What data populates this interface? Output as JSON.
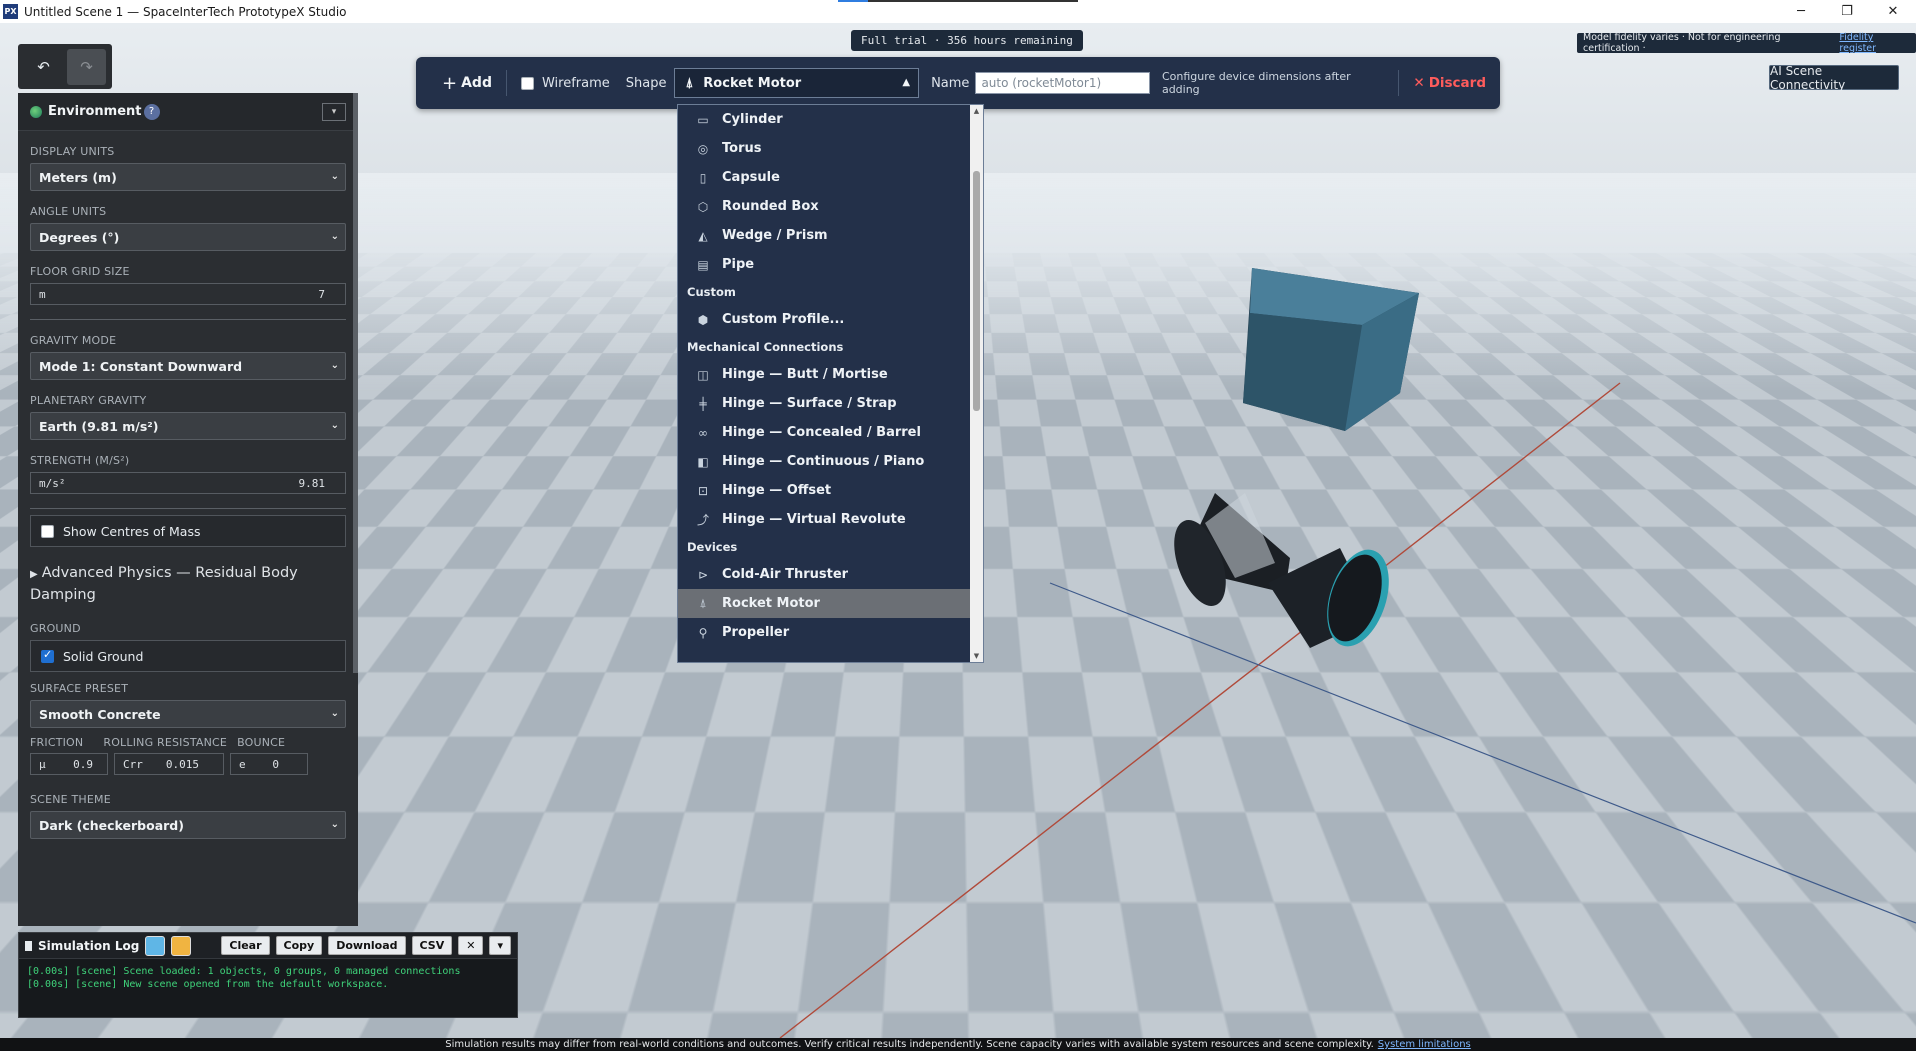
{
  "window": {
    "title": "Untitled Scene 1 — SpaceInterTech PrototypeX Studio",
    "app_icon": "PX",
    "controls": [
      "minimize-icon",
      "restore-icon",
      "close-icon"
    ]
  },
  "trial": {
    "text": "Full trial · 356 hours remaining"
  },
  "fidelity": {
    "text": "Model fidelity varies · Not for engineering certification ·",
    "link": "Fidelity register"
  },
  "ai_button": {
    "label": "AI Scene Connectivity"
  },
  "history": {
    "undo_icon": "undo-icon",
    "redo_icon": "redo-icon",
    "undo_glyph": "↶",
    "redo_glyph": "↷"
  },
  "environment": {
    "title": "Environment",
    "help": "?",
    "collapse_glyph": "▾",
    "display_units": {
      "label": "DISPLAY UNITS",
      "value": "Meters (m)"
    },
    "angle_units": {
      "label": "ANGLE UNITS",
      "value": "Degrees (°)"
    },
    "floor_grid": {
      "label": "FLOOR GRID SIZE",
      "unit": "m",
      "value": "7"
    },
    "gravity_mode": {
      "label": "GRAVITY MODE",
      "value": "Mode 1: Constant Downward"
    },
    "planetary_gravity": {
      "label": "PLANETARY GRAVITY",
      "value": "Earth (9.81 m/s²)"
    },
    "strength": {
      "label": "STRENGTH (M/S²)",
      "unit": "m/s²",
      "value": "9.81"
    },
    "show_com": {
      "label": "Show Centres of Mass",
      "checked": false
    },
    "advanced": {
      "label": "Advanced Physics — Residual Body Damping"
    },
    "ground": {
      "label": "GROUND",
      "solid_label": "Solid Ground",
      "checked": true
    },
    "surface_preset": {
      "label": "SURFACE PRESET",
      "value": "Smooth Concrete"
    },
    "friction": {
      "label": "FRICTION",
      "unit": "μ",
      "value": "0.9"
    },
    "rolling": {
      "label": "ROLLING RESISTANCE",
      "unit": "Crr",
      "value": "0.015"
    },
    "bounce": {
      "label": "BOUNCE",
      "unit": "e",
      "value": "0"
    },
    "scene_theme": {
      "label": "SCENE THEME",
      "value": "Dark (checkerboard)"
    }
  },
  "simlog": {
    "title": "Simulation Log",
    "swatch_colors": [
      "#5fb6e6",
      "#f0b441"
    ],
    "buttons": {
      "clear": "Clear",
      "copy": "Copy",
      "download": "Download",
      "csv": "CSV",
      "close": "✕",
      "more": "▾"
    },
    "lines": [
      "[0.00s] [scene] Scene loaded: 1 objects, 0 groups, 0 managed connections",
      "[0.00s] [scene] New scene opened from the default workspace."
    ]
  },
  "toolbar": {
    "add_label": "Add",
    "wireframe_label": "Wireframe",
    "wireframe_checked": false,
    "shape_label": "Shape",
    "shape_value": "Rocket Motor",
    "name_label": "Name",
    "name_placeholder": "auto (rocketMotor1)",
    "hint": "Configure device dimensions after adding",
    "discard_label": "Discard"
  },
  "shape_dropdown": {
    "items": [
      {
        "kind": "item",
        "label": "Cylinder",
        "icon": "cylinder-icon",
        "glyph": "▭"
      },
      {
        "kind": "item",
        "label": "Torus",
        "icon": "torus-icon",
        "glyph": "◎"
      },
      {
        "kind": "item",
        "label": "Capsule",
        "icon": "capsule-icon",
        "glyph": "▯"
      },
      {
        "kind": "item",
        "label": "Rounded Box",
        "icon": "rounded-box-icon",
        "glyph": "⬡"
      },
      {
        "kind": "item",
        "label": "Wedge / Prism",
        "icon": "wedge-icon",
        "glyph": "◭"
      },
      {
        "kind": "item",
        "label": "Pipe",
        "icon": "pipe-icon",
        "glyph": "▤"
      },
      {
        "kind": "group",
        "label": "Custom"
      },
      {
        "kind": "item",
        "label": "Custom Profile...",
        "icon": "custom-profile-icon",
        "glyph": "⬢"
      },
      {
        "kind": "group",
        "label": "Mechanical Connections"
      },
      {
        "kind": "item",
        "label": "Hinge — Butt / Mortise",
        "icon": "hinge-butt-icon",
        "glyph": "◫"
      },
      {
        "kind": "item",
        "label": "Hinge — Surface / Strap",
        "icon": "hinge-strap-icon",
        "glyph": "╪"
      },
      {
        "kind": "item",
        "label": "Hinge — Concealed / Barrel",
        "icon": "hinge-barrel-icon",
        "glyph": "∞"
      },
      {
        "kind": "item",
        "label": "Hinge — Continuous / Piano",
        "icon": "hinge-piano-icon",
        "glyph": "◧"
      },
      {
        "kind": "item",
        "label": "Hinge — Offset",
        "icon": "hinge-offset-icon",
        "glyph": "⊡"
      },
      {
        "kind": "item",
        "label": "Hinge — Virtual Revolute",
        "icon": "virtual-revolute-icon",
        "glyph": "⤴"
      },
      {
        "kind": "group",
        "label": "Devices"
      },
      {
        "kind": "item",
        "label": "Cold-Air Thruster",
        "icon": "thruster-icon",
        "glyph": "⊳"
      },
      {
        "kind": "item",
        "label": "Rocket Motor",
        "icon": "rocket-icon",
        "glyph": "⍋",
        "selected": true
      },
      {
        "kind": "item",
        "label": "Propeller",
        "icon": "propeller-icon",
        "glyph": "⚲"
      }
    ]
  },
  "status": {
    "text": "Simulation results may differ from real-world conditions and outcomes. Verify critical results independently. Scene capacity varies with available system resources and scene complexity.",
    "link": "System limitations"
  }
}
